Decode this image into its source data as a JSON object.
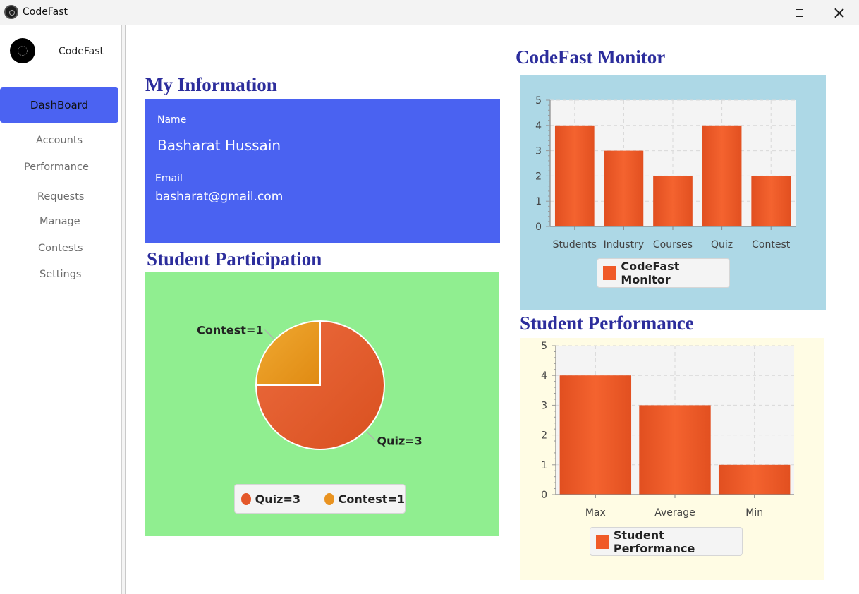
{
  "window": {
    "title": "CodeFast"
  },
  "sidebar": {
    "brand": "CodeFast",
    "active_item": "DashBoard",
    "items": [
      "Accounts",
      "Performance",
      "Requests",
      "Manage",
      "Contests",
      "Settings"
    ]
  },
  "headings": {
    "my_information": "My Information",
    "student_participation": "Student Participation",
    "codefast_monitor": "CodeFast Monitor",
    "student_performance": "Student Performance"
  },
  "info": {
    "name_label": "Name",
    "name_value": "Basharat Hussain",
    "email_label": "Email",
    "email_value": "basharat@gmail.com"
  },
  "colors": {
    "accent": "#4a62f1",
    "bar": "#f05a28",
    "pie_quiz": "#e4582a",
    "pie_contest": "#e99320",
    "heading": "#2c2d9c"
  },
  "chart_data": [
    {
      "type": "pie",
      "categories": [
        "Quiz=3",
        "Contest=1"
      ],
      "values": [
        3,
        1
      ],
      "legend": [
        "Quiz=3",
        "Contest=1"
      ],
      "legend_position": "bottom"
    },
    {
      "type": "bar",
      "categories": [
        "Students",
        "Industry",
        "Courses",
        "Quiz",
        "Contest"
      ],
      "values": [
        4,
        3,
        2,
        4,
        2
      ],
      "series": [
        {
          "name": "CodeFast Monitor",
          "values": [
            4,
            3,
            2,
            4,
            2
          ]
        }
      ],
      "ylim": [
        0,
        5
      ],
      "yticks": [
        0,
        1,
        2,
        3,
        4,
        5
      ],
      "grid": true,
      "legend_position": "bottom"
    },
    {
      "type": "bar",
      "categories": [
        "Max",
        "Average",
        "Min"
      ],
      "values": [
        4,
        3,
        1
      ],
      "series": [
        {
          "name": "Student Performance",
          "values": [
            4,
            3,
            1
          ]
        }
      ],
      "ylim": [
        0,
        5
      ],
      "yticks": [
        0,
        1,
        2,
        3,
        4,
        5
      ],
      "grid": true,
      "legend_position": "bottom"
    }
  ]
}
